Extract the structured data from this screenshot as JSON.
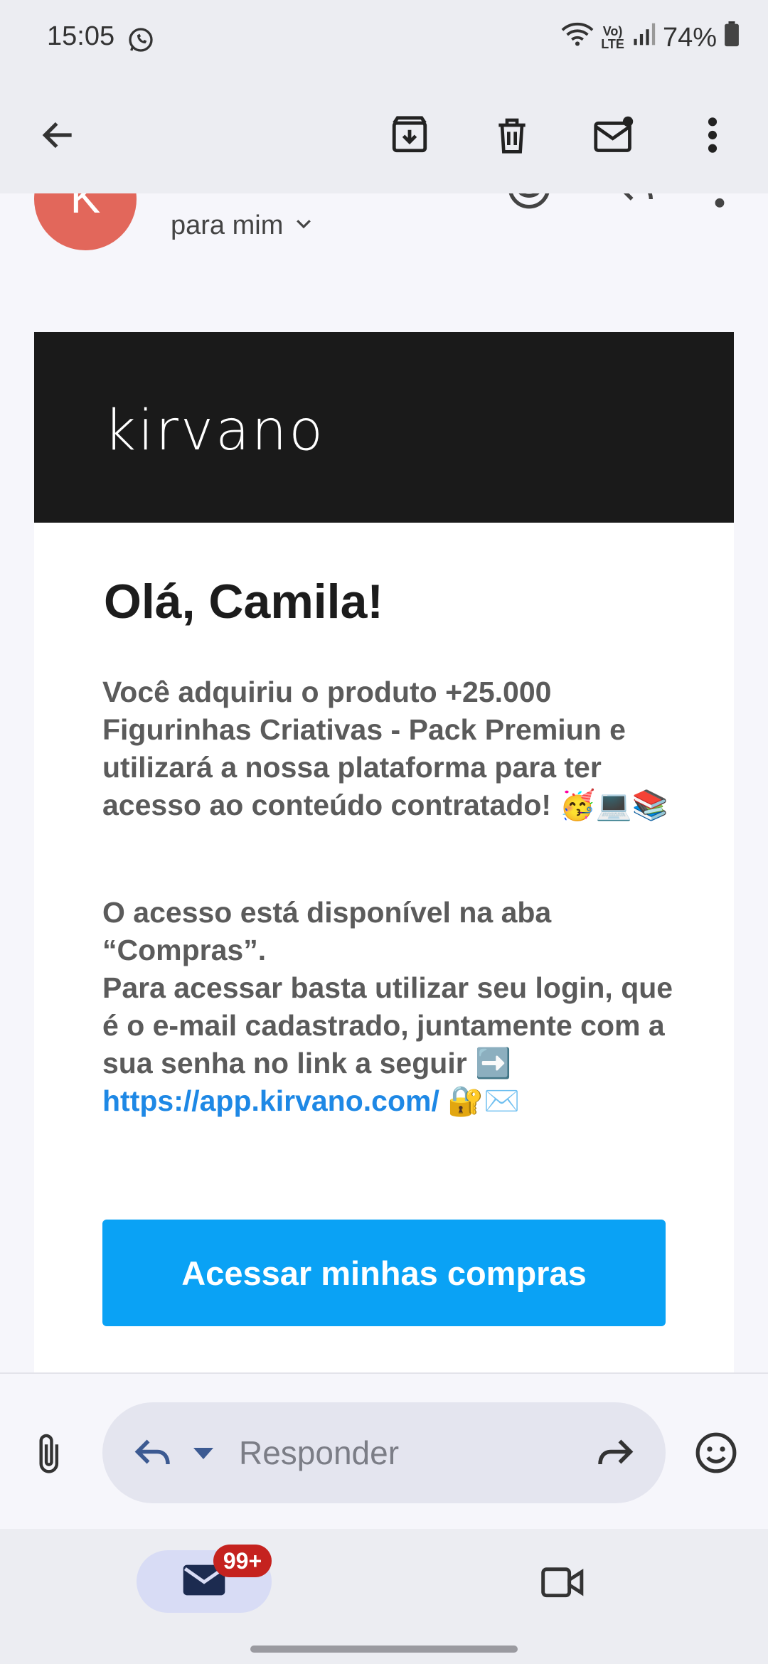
{
  "status_bar": {
    "time": "15:05",
    "battery": "74%",
    "icons": [
      "whatsapp-icon",
      "wifi-icon",
      "volte-icon",
      "signal-icon",
      "battery-icon"
    ]
  },
  "toolbar": {
    "icons": [
      "back-arrow-icon",
      "archive-icon",
      "delete-icon",
      "mark-unread-icon",
      "more-vert-icon"
    ]
  },
  "message_header": {
    "avatar_letter": "K",
    "recipient_label": "para mim",
    "avatar_color": "#e2675b"
  },
  "email": {
    "brand": "kirvano",
    "greeting": "Olá, Camila!",
    "paragraph1": "Você adquiriu o produto +25.000 Figurinhas Criativas - Pack Premiun e utilizará a nossa plataforma para ter acesso ao conteúdo contratado! 🥳💻📚",
    "paragraph2_line1": "O acesso está disponível na aba “Compras”.",
    "paragraph2_line2": "Para acessar basta utilizar seu login, que é o e-mail cadastrado, juntamente com a sua senha no link a seguir ➡️",
    "link": "https://app.kirvano.com/",
    "link_suffix": " 🔐✉️",
    "cta_label": "Acessar minhas compras",
    "cta_color": "#0aa2f5"
  },
  "reply_bar": {
    "placeholder": "Responder"
  },
  "bottom_nav": {
    "mail_badge": "99+"
  }
}
